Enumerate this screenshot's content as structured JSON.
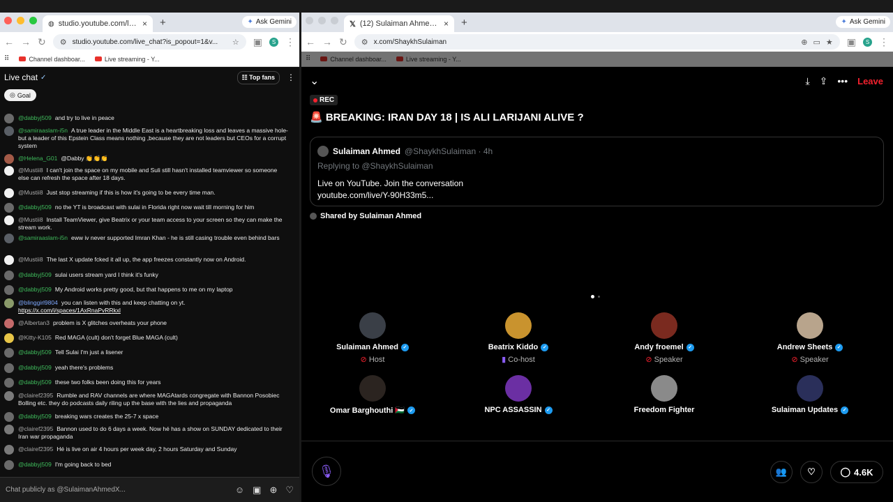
{
  "left_window": {
    "tab_title": "studio.youtube.com/live_chat",
    "url": "studio.youtube.com/live_chat?is_popout=1&v...",
    "ask_gemini": "Ask Gemini",
    "bookmarks": [
      "Channel dashboar...",
      "Live streaming - Y..."
    ],
    "profile_initial": "S",
    "chat": {
      "title": "Live chat",
      "top_fans": "Top fans",
      "goal": "Goal",
      "input_placeholder": "Chat publicly as @SulaimanAhmedX...",
      "messages": [
        {
          "author": "@dabbyj509",
          "text": "and try to live in peace"
        },
        {
          "author": "@samiraaslam-i5n",
          "text": "A true leader in the Middle East is a heartbreaking loss and leaves a massive hole- but a leader of this Epstein Class means nothing ,because they are not leaders but CEOs for a corrupt system"
        },
        {
          "author": "@Helena_G01",
          "text": "@Dabby 👏👏👏"
        },
        {
          "author": "@Mustii8",
          "text": "I can't join the space on my mobile and Suli still hasn't installed teamviewer so someone else can refresh the space after 18 days."
        },
        {
          "author": "@Mustii8",
          "text": "Just stop streaming if this is how it's going to be every time man."
        },
        {
          "author": "@dabbyj509",
          "text": "no the YT is broadcast with sulai in Florida right now wait till morning for him"
        },
        {
          "author": "@Mustii8",
          "text": "Install TeamViewer, give Beatrix or your team access to your screen so they can make the stream work."
        },
        {
          "author": "@samiraaslam-i5n",
          "text": "eww iv never supported Imran Khan - he is still casing trouble even behind bars"
        },
        {
          "author": "@Mustii8",
          "text": "The last X update fcked it all up, the app freezes constantly now on Android."
        },
        {
          "author": "@dabbyj509",
          "text": "sulai users stream yard I think it's funky"
        },
        {
          "author": "@dabbyj509",
          "text": "My Android works pretty good, but that happens to me on my laptop"
        },
        {
          "author": "@blinggirl9804",
          "text": "you can listen with this and keep chatting on yt.",
          "link": "https://x.com/i/spaces/1AxRnaPvRRkxl"
        },
        {
          "author": "@Albertan3",
          "text": "problem is X glitches overheats your phone"
        },
        {
          "author": "@Kitty-K105",
          "text": "Red MAGA (cult) don't forget Blue MAGA (cult)"
        },
        {
          "author": "@dabbyj509",
          "text": "Tell Sulai I'm just a lisener"
        },
        {
          "author": "@dabbyj509",
          "text": "yeah there's problems"
        },
        {
          "author": "@dabbyj509",
          "text": "these two folks been doing this for years"
        },
        {
          "author": "@clairef2395",
          "text": "Rumble and RAV channels are where MAGAtards congregate with Bannon Posobiec Bolling etc. they do podcasts daily riling up the base with the lies and propaganda"
        },
        {
          "author": "@dabbyj509",
          "text": "breaking wars creates the 25-7 x space"
        },
        {
          "author": "@clairef2395",
          "text": "Bannon used to do 6 days a week. Now hé has a show on SUNDAY dedicated to their Iran war propaganda"
        },
        {
          "author": "@clairef2395",
          "text": "Hé is live on air 4 hours per week day, 2 hours Saturday and Sunday"
        },
        {
          "author": "@dabbyj509",
          "text": "I'm going back to bed"
        }
      ]
    }
  },
  "right_window": {
    "tab_title": "(12) Sulaiman Ahmed (@ShaykhSulaiman)",
    "url": "x.com/ShaykhSulaiman",
    "ask_gemini": "Ask Gemini",
    "bookmarks": [
      "Channel dashboar...",
      "Live streaming - Y..."
    ],
    "profile_initial": "S",
    "space": {
      "leave": "Leave",
      "rec": "REC",
      "title": "🚨 BREAKING: IRAN DAY 18 | IS ALI LARIJANI ALIVE ?",
      "card": {
        "name": "Sulaiman Ahmed",
        "handle": "@ShaykhSulaiman · 4h",
        "replying": "Replying to @ShaykhSulaiman",
        "body_line1": "Live on YouTube. Join the conversation",
        "body_line2": "youtube.com/live/Y-90H33m5..."
      },
      "shared_by": "Shared by Sulaiman Ahmed",
      "speakers": [
        {
          "name": "Sulaiman Ahmed",
          "role": "Host",
          "verified": true,
          "color": "#3a3f47"
        },
        {
          "name": "Beatrix Kiddo",
          "role": "Co-host",
          "verified": true,
          "color": "#c9932e"
        },
        {
          "name": "Andy froemel",
          "role": "Speaker",
          "verified": true,
          "color": "#7a2a1f"
        },
        {
          "name": "Andrew Sheets",
          "role": "Speaker",
          "verified": true,
          "color": "#b8a48c"
        },
        {
          "name": "Omar Barghouthi 🇵🇸",
          "role": "",
          "verified": true,
          "color": "#2b2420"
        },
        {
          "name": "NPC ASSASSIN",
          "role": "",
          "verified": true,
          "color": "#6b2fa3"
        },
        {
          "name": "Freedom Fighter",
          "role": "",
          "verified": false,
          "color": "#8a8a8a"
        },
        {
          "name": "Sulaiman Updates",
          "role": "",
          "verified": true,
          "color": "#2a2f5a"
        }
      ],
      "reactions_count": "4.6K"
    }
  }
}
